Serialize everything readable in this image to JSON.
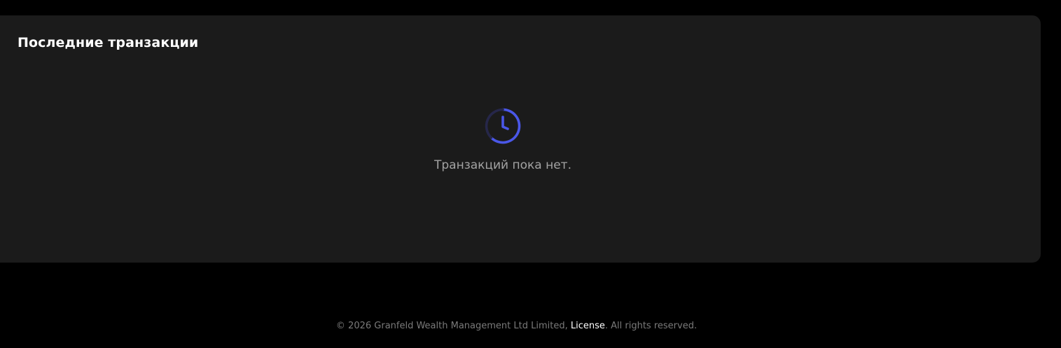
{
  "transactions": {
    "title": "Последние транзакции",
    "empty_icon": "clock-icon",
    "empty_message": "Транзакций пока нет."
  },
  "footer": {
    "prefix": "© 2026 Granfeld Wealth Management Ltd Limited, ",
    "license_link": "License",
    "suffix": ". All rights reserved."
  },
  "colors": {
    "background": "#000000",
    "card": "#1b1b1b",
    "accent": "#4a57e8",
    "title": "#ffffff",
    "muted_text": "#a3a3a3"
  }
}
